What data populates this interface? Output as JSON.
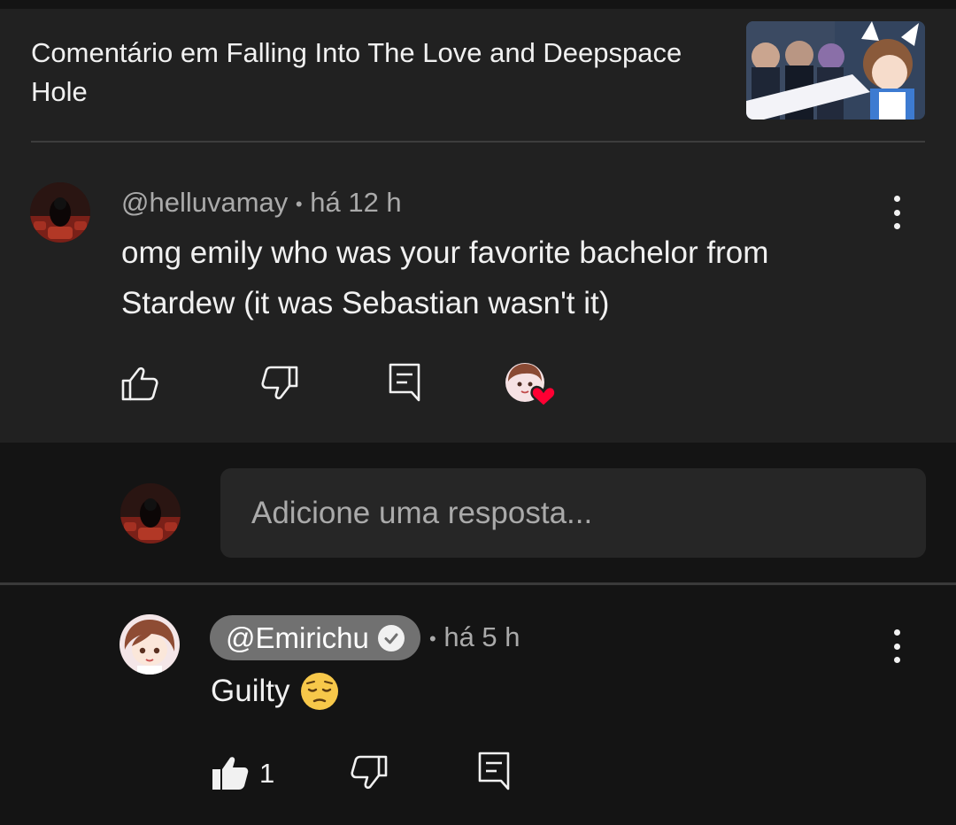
{
  "context": {
    "title": "Comentário em Falling Into The Love and Deepspace Hole",
    "thumbnail_icon": "video-thumbnail"
  },
  "comment": {
    "author": "@helluvamay",
    "separator": "•",
    "time": "há 12 h",
    "text": "omg emily who was your favorite bachelor from Stardew (it was Sebastian wasn't it)",
    "icons": [
      "like-icon",
      "dislike-icon",
      "reply-icon",
      "creator-heart-icon"
    ],
    "menu_icon": "more-vert-icon"
  },
  "reply_box": {
    "placeholder": "Adicione uma resposta..."
  },
  "reply": {
    "author": "@Emirichu",
    "verified": true,
    "separator": "•",
    "time": "há 5 h",
    "text": "Guilty",
    "emoji": "😔",
    "like_count": "1",
    "icons": [
      "like-filled-icon",
      "dislike-icon",
      "reply-icon"
    ],
    "menu_icon": "more-vert-icon"
  },
  "colors": {
    "background": "#0f0f0f",
    "card": "#212121",
    "text_primary": "#f1f1f1",
    "text_secondary": "#aaaaaa",
    "heart": "#ff0033",
    "author_pill": "#717171"
  }
}
